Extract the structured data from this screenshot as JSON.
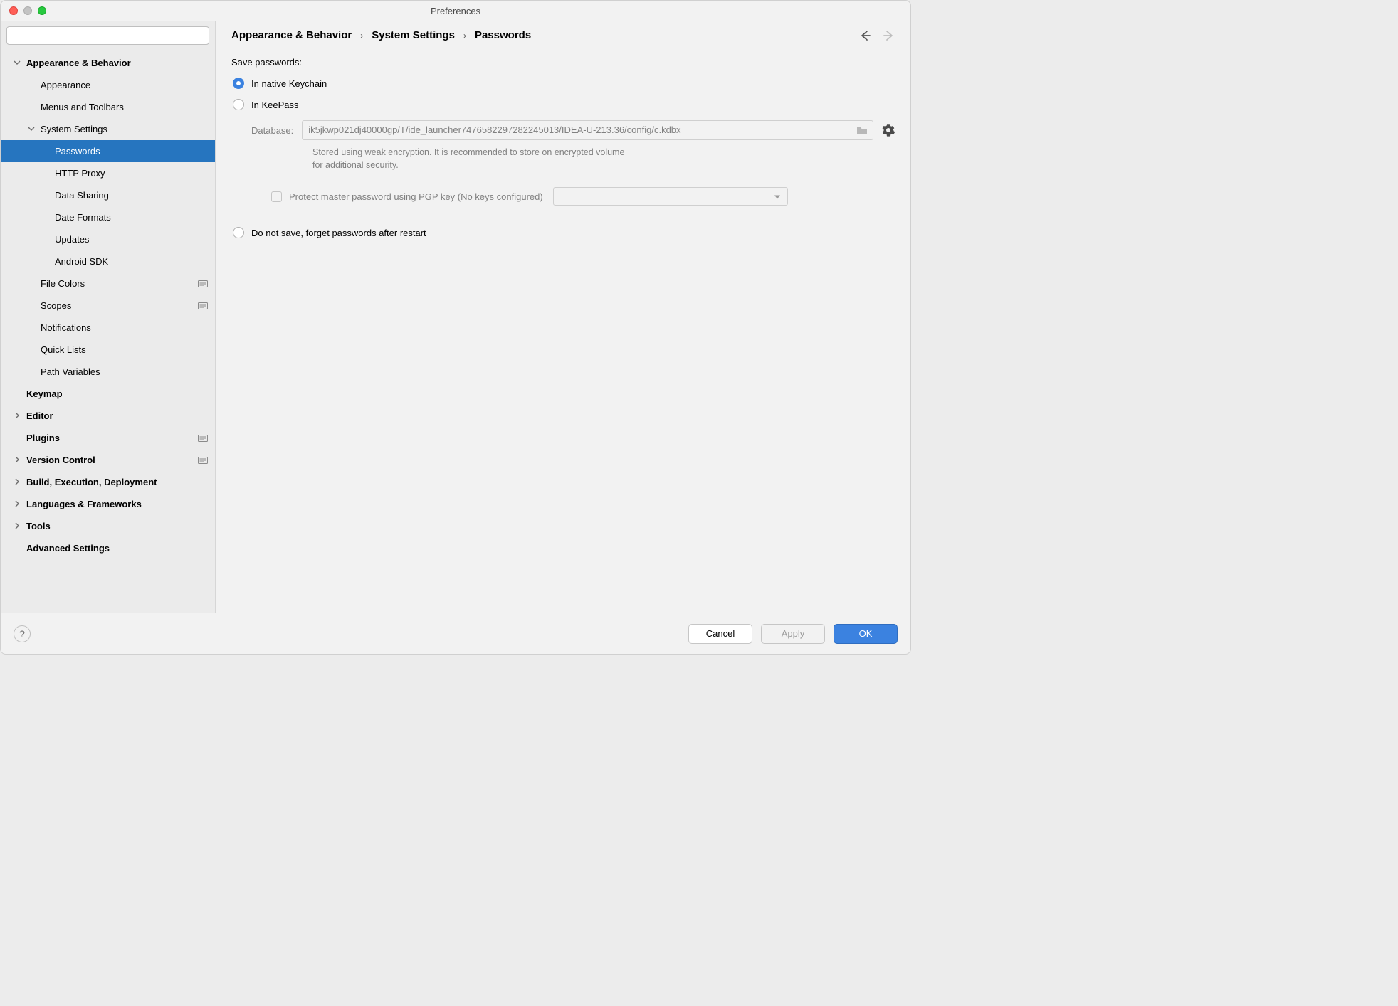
{
  "window": {
    "title": "Preferences"
  },
  "search": {
    "placeholder": ""
  },
  "sidebar": {
    "items": [
      {
        "label": "Appearance & Behavior",
        "indent": 0,
        "bold": true,
        "arrow": "down",
        "badge": false
      },
      {
        "label": "Appearance",
        "indent": 1,
        "bold": false,
        "arrow": "none",
        "badge": false
      },
      {
        "label": "Menus and Toolbars",
        "indent": 1,
        "bold": false,
        "arrow": "none",
        "badge": false
      },
      {
        "label": "System Settings",
        "indent": 1,
        "bold": false,
        "arrow": "down",
        "badge": false
      },
      {
        "label": "Passwords",
        "indent": 2,
        "bold": false,
        "arrow": "none",
        "selected": true,
        "badge": false
      },
      {
        "label": "HTTP Proxy",
        "indent": 2,
        "bold": false,
        "arrow": "none",
        "badge": false
      },
      {
        "label": "Data Sharing",
        "indent": 2,
        "bold": false,
        "arrow": "none",
        "badge": false
      },
      {
        "label": "Date Formats",
        "indent": 2,
        "bold": false,
        "arrow": "none",
        "badge": false
      },
      {
        "label": "Updates",
        "indent": 2,
        "bold": false,
        "arrow": "none",
        "badge": false
      },
      {
        "label": "Android SDK",
        "indent": 2,
        "bold": false,
        "arrow": "none",
        "badge": false
      },
      {
        "label": "File Colors",
        "indent": 1,
        "bold": false,
        "arrow": "none",
        "badge": true
      },
      {
        "label": "Scopes",
        "indent": 1,
        "bold": false,
        "arrow": "none",
        "badge": true
      },
      {
        "label": "Notifications",
        "indent": 1,
        "bold": false,
        "arrow": "none",
        "badge": false
      },
      {
        "label": "Quick Lists",
        "indent": 1,
        "bold": false,
        "arrow": "none",
        "badge": false
      },
      {
        "label": "Path Variables",
        "indent": 1,
        "bold": false,
        "arrow": "none",
        "badge": false
      },
      {
        "label": "Keymap",
        "indent": 0,
        "bold": true,
        "arrow": "none",
        "badge": false
      },
      {
        "label": "Editor",
        "indent": 0,
        "bold": true,
        "arrow": "right",
        "badge": false
      },
      {
        "label": "Plugins",
        "indent": 0,
        "bold": true,
        "arrow": "none",
        "badge": true
      },
      {
        "label": "Version Control",
        "indent": 0,
        "bold": true,
        "arrow": "right",
        "badge": true
      },
      {
        "label": "Build, Execution, Deployment",
        "indent": 0,
        "bold": true,
        "arrow": "right",
        "badge": false
      },
      {
        "label": "Languages & Frameworks",
        "indent": 0,
        "bold": true,
        "arrow": "right",
        "badge": false
      },
      {
        "label": "Tools",
        "indent": 0,
        "bold": true,
        "arrow": "right",
        "badge": false
      },
      {
        "label": "Advanced Settings",
        "indent": 0,
        "bold": true,
        "arrow": "none",
        "badge": false
      }
    ]
  },
  "breadcrumb": {
    "parts": [
      "Appearance & Behavior",
      "System Settings",
      "Passwords"
    ]
  },
  "panel": {
    "save_passwords_label": "Save passwords:",
    "option_keychain": "In native Keychain",
    "option_keepass": "In KeePass",
    "option_donotsave": "Do not save, forget passwords after restart",
    "db_label": "Database:",
    "db_value": "ik5jkwp021dj40000gp/T/ide_launcher7476582297282245013/IDEA-U-213.36/config/c.kdbx",
    "db_hint": "Stored using weak encryption. It is recommended to store on encrypted volume for additional security.",
    "protect_label": "Protect master password using PGP key (No keys configured)"
  },
  "footer": {
    "cancel": "Cancel",
    "apply": "Apply",
    "ok": "OK"
  }
}
